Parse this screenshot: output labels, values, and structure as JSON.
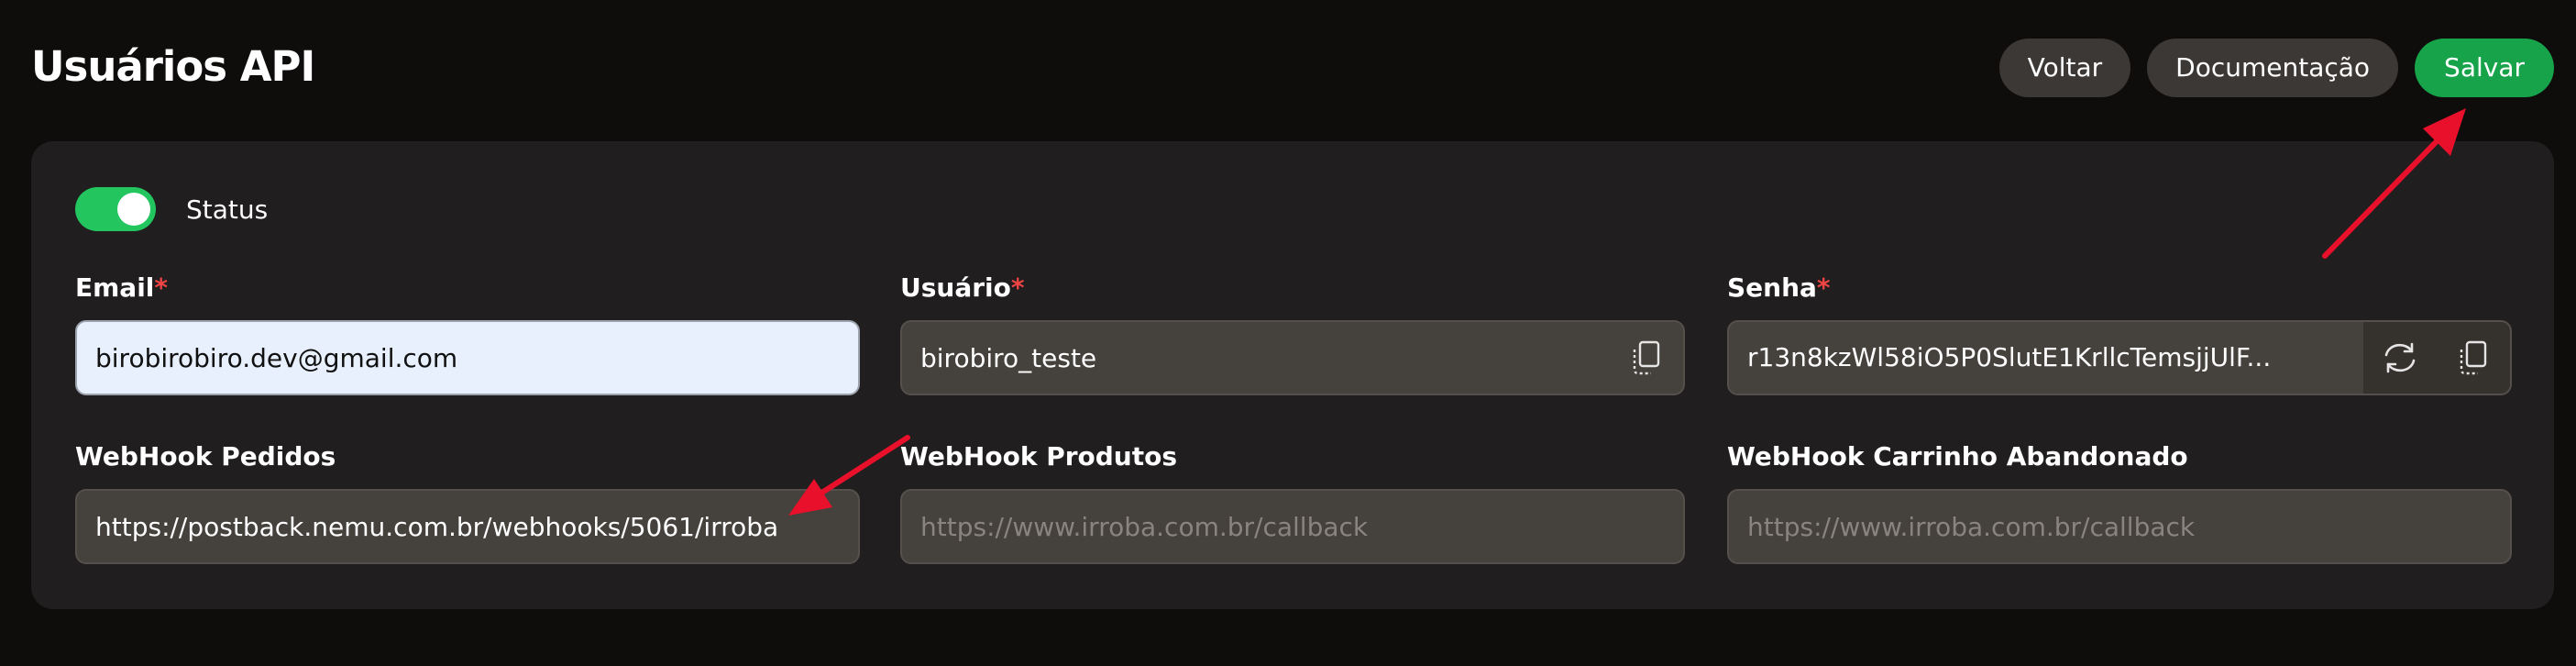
{
  "header": {
    "title": "Usuários API",
    "buttons": {
      "back": "Voltar",
      "docs": "Documentação",
      "save": "Salvar"
    }
  },
  "form": {
    "status_label": "Status",
    "status_on": true,
    "email": {
      "label": "Email",
      "required_mark": "*",
      "value": "birobirobiro.dev@gmail.com"
    },
    "usuario": {
      "label": "Usuário",
      "required_mark": "*",
      "value": "birobiro_teste"
    },
    "senha": {
      "label": "Senha",
      "required_mark": "*",
      "value": "r13n8kzWl58iO5P0SlutE1KrllcTemsjjUlF..."
    },
    "webhook_pedidos": {
      "label": "WebHook Pedidos",
      "value": "https://postback.nemu.com.br/webhooks/5061/irroba"
    },
    "webhook_produtos": {
      "label": "WebHook Produtos",
      "placeholder": "https://www.irroba.com.br/callback"
    },
    "webhook_carrinho": {
      "label": "WebHook Carrinho Abandonado",
      "placeholder": "https://www.irroba.com.br/callback"
    }
  },
  "colors": {
    "accent": "#16a34a",
    "toggle_on": "#22c55e",
    "required": "#ef4444",
    "annotation_arrow": "#e8102a"
  },
  "icons": [
    "copy-icon",
    "refresh-icon",
    "arrow-annotation"
  ]
}
